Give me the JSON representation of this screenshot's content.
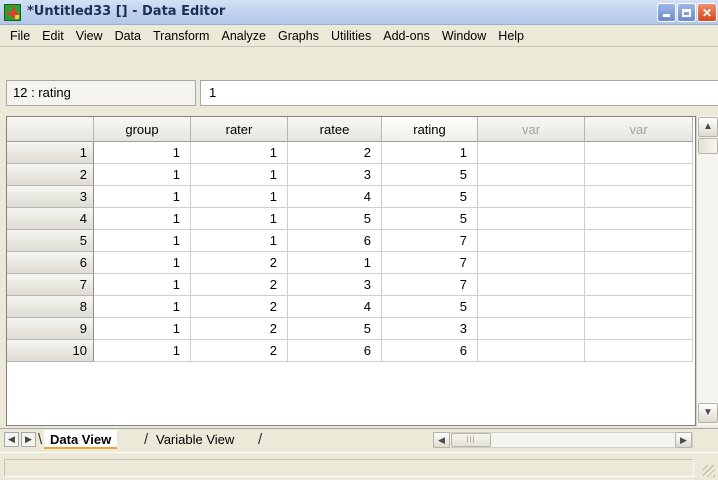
{
  "window": {
    "title": "*Untitled33 [] - Data Editor"
  },
  "menu": [
    "File",
    "Edit",
    "View",
    "Data",
    "Transform",
    "Analyze",
    "Graphs",
    "Utilities",
    "Add-ons",
    "Window",
    "Help"
  ],
  "editor": {
    "cell_reference": "12 : rating",
    "cell_value": "1"
  },
  "grid": {
    "columns": [
      "group",
      "rater",
      "ratee",
      "rating",
      "var",
      "var"
    ],
    "rows": [
      {
        "num": "1",
        "values": [
          "1",
          "1",
          "2",
          "1",
          "",
          ""
        ]
      },
      {
        "num": "2",
        "values": [
          "1",
          "1",
          "3",
          "5",
          "",
          ""
        ]
      },
      {
        "num": "3",
        "values": [
          "1",
          "1",
          "4",
          "5",
          "",
          ""
        ]
      },
      {
        "num": "4",
        "values": [
          "1",
          "1",
          "5",
          "5",
          "",
          ""
        ]
      },
      {
        "num": "5",
        "values": [
          "1",
          "1",
          "6",
          "7",
          "",
          ""
        ]
      },
      {
        "num": "6",
        "values": [
          "1",
          "2",
          "1",
          "7",
          "",
          ""
        ]
      },
      {
        "num": "7",
        "values": [
          "1",
          "2",
          "3",
          "7",
          "",
          ""
        ]
      },
      {
        "num": "8",
        "values": [
          "1",
          "2",
          "4",
          "5",
          "",
          ""
        ]
      },
      {
        "num": "9",
        "values": [
          "1",
          "2",
          "5",
          "3",
          "",
          ""
        ]
      },
      {
        "num": "10",
        "values": [
          "1",
          "2",
          "6",
          "6",
          "",
          ""
        ]
      }
    ]
  },
  "tabs": {
    "data_view": "Data View",
    "variable_view": "Variable View"
  },
  "colors": {
    "active_tab_underline": "#f1a33a",
    "titlebar": "#c3d5ef",
    "close_button": "#d3461c"
  }
}
